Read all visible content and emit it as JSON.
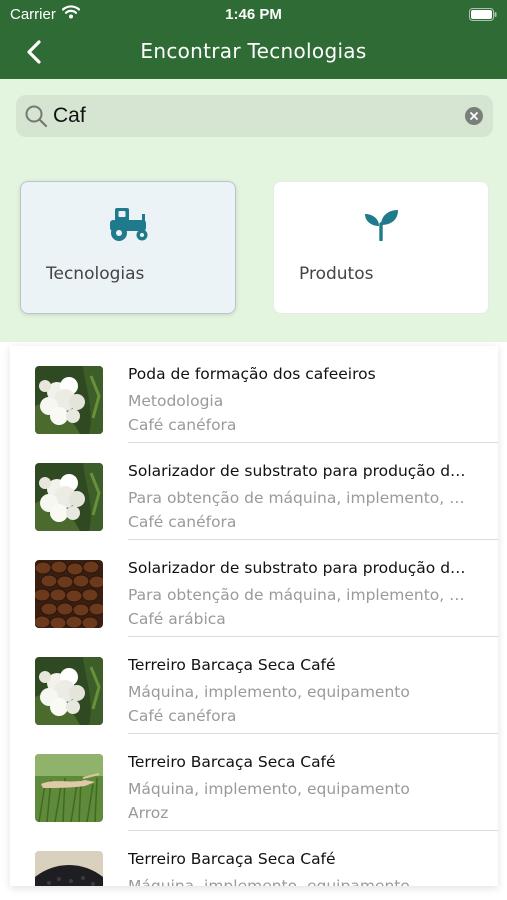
{
  "status_bar": {
    "carrier": "Carrier",
    "time": "1:46 PM"
  },
  "nav": {
    "title": "Encontrar Tecnologias",
    "back_icon": "chevron-left-icon"
  },
  "search": {
    "value": "Caf",
    "icon": "search-icon",
    "clear_icon": "clear-icon"
  },
  "categories": [
    {
      "label": "Tecnologias",
      "icon": "tractor-icon",
      "selected": true
    },
    {
      "label": "Produtos",
      "icon": "sprout-icon",
      "selected": false
    }
  ],
  "results": [
    {
      "title": "Poda de formação dos cafeeiros",
      "type": "Metodologia",
      "crop": "Café canéfora",
      "image": "coffee-flower"
    },
    {
      "title": "Solarizador de substrato para produção de mudas",
      "type": "Para obtenção de máquina, implemento, equipamento",
      "crop": "Café canéfora",
      "image": "coffee-flower"
    },
    {
      "title": "Solarizador de substrato para produção de mudas",
      "type": "Para obtenção de máquina, implemento, equipamento",
      "crop": "Café arábica",
      "image": "coffee-beans"
    },
    {
      "title": "Terreiro Barcaça Seca Café",
      "type": "Máquina, implemento, equipamento",
      "crop": "Café canéfora",
      "image": "coffee-flower"
    },
    {
      "title": "Terreiro Barcaça Seca Café",
      "type": "Máquina, implemento, equipamento",
      "crop": "Arroz",
      "image": "rice-field"
    },
    {
      "title": "Terreiro Barcaça Seca Café",
      "type": "Máquina, implemento, equipamento",
      "crop": "",
      "image": "dark-grains"
    }
  ],
  "colors": {
    "header": "#2f6b35",
    "accent": "#1f7a8c",
    "upper_bg": "#e3f4df",
    "search_bg": "#d6e4d2"
  }
}
